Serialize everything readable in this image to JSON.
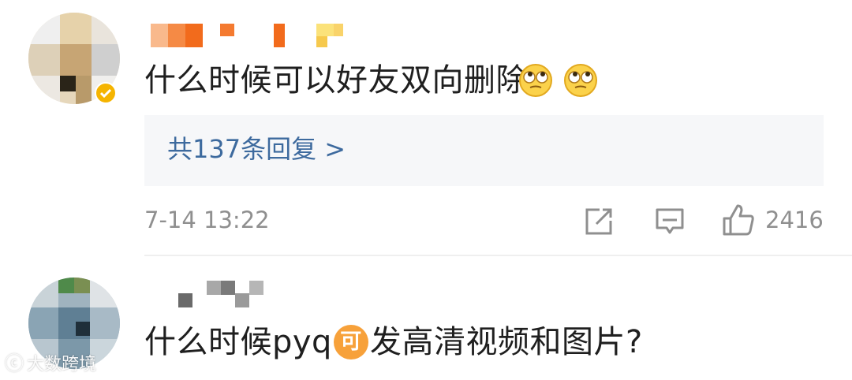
{
  "comments": [
    {
      "text": "什么时候可以好友双向删除",
      "emoji_icons": [
        "rolling-eyes-face-icon",
        "rolling-eyes-face-icon"
      ],
      "replies_link": "共137条回复 >",
      "timestamp": "7-14 13:22",
      "like_count": "2416"
    },
    {
      "text_before_badge": "什么时候pyq",
      "badge": "可",
      "text_after_badge": "发高清视频和图片?"
    }
  ],
  "watermark": "大数跨境",
  "colors": {
    "link": "#3d6a9e",
    "meta": "#8f8f8f",
    "badge": "#f7a13a",
    "verified_badge": "#f5b400"
  }
}
